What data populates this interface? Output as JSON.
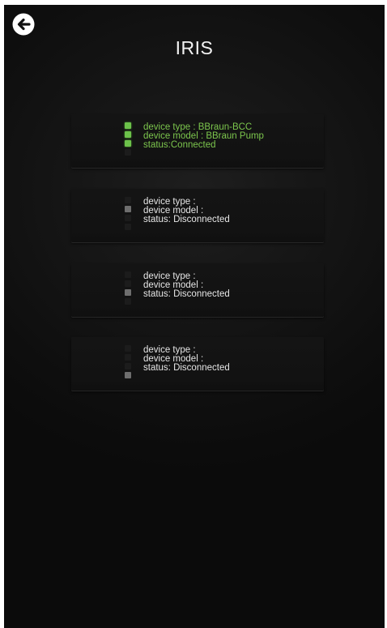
{
  "app": {
    "title": "IRIS"
  },
  "nav": {
    "back_icon": "arrow-left-circle-icon"
  },
  "colors": {
    "background": "#0e0e0e",
    "card": "#131313",
    "connected_text": "#7cc64d",
    "led_green": "#6cc24a",
    "led_gray": "#6e6e6e",
    "led_off": "#1c1c1c",
    "text": "#e6e6e6"
  },
  "devices": [
    {
      "type_label": "device type : BBraun-BCC",
      "model_label": "device model : BBraun Pump",
      "status_label": "status:Connected",
      "connected": true,
      "leds": [
        "green",
        "green",
        "green",
        "off"
      ]
    },
    {
      "type_label": "device type :",
      "model_label": "device model :",
      "status_label": "status: Disconnected",
      "connected": false,
      "leds": [
        "off",
        "gray",
        "off",
        "off"
      ]
    },
    {
      "type_label": "device type :",
      "model_label": "device model :",
      "status_label": "status: Disconnected",
      "connected": false,
      "leds": [
        "off",
        "off",
        "gray",
        "off"
      ]
    },
    {
      "type_label": "device type :",
      "model_label": "device model :",
      "status_label": "status: Disconnected",
      "connected": false,
      "leds": [
        "off",
        "off",
        "off",
        "gray"
      ]
    }
  ]
}
